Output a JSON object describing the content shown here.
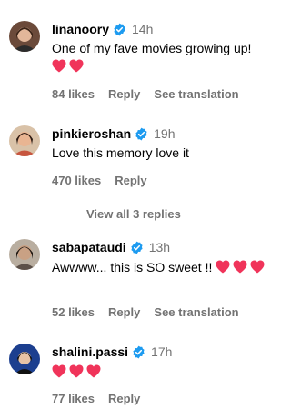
{
  "comments": [
    {
      "username": "linanoory",
      "time": "14h",
      "text": "One of my fave movies growing up!",
      "hearts": 2,
      "likes": "84 likes",
      "reply": "Reply",
      "translation": "See translation",
      "avatar_color": "#b07a5a"
    },
    {
      "username": "pinkieroshan",
      "time": "19h",
      "text": "Love this memory love it",
      "hearts": 0,
      "likes": "470 likes",
      "reply": "Reply",
      "avatar_color": "#c98a6c"
    },
    {
      "username": "sabapataudi",
      "time": "13h",
      "text": "Awwww... this is SO sweet !!",
      "hearts": 3,
      "likes": "52 likes",
      "reply": "Reply",
      "translation": "See translation",
      "avatar_color": "#a5968a"
    },
    {
      "username": "shalini.passi",
      "time": "17h",
      "text": "",
      "hearts": 3,
      "likes": "77 likes",
      "reply": "Reply",
      "avatar_color": "#1c3f8f"
    }
  ],
  "view_replies": "View all 3 replies",
  "colors": {
    "verified": "#1d9bf0",
    "heart": "#f0345a",
    "muted": "#737373"
  },
  "icons": {
    "verified": "verified-badge-icon",
    "heart": "heart-emoji-icon"
  }
}
